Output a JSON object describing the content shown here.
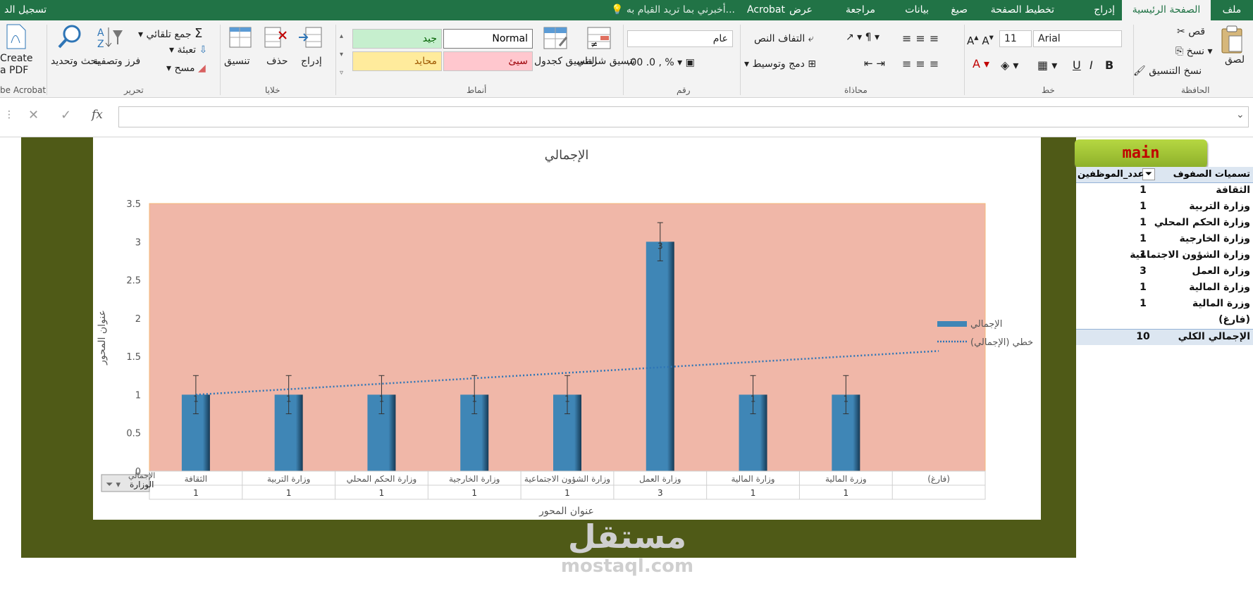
{
  "tabs": {
    "file": "ملف",
    "home": "الصفحة الرئيسية",
    "insert": "إدراج",
    "page_layout": "تخطيط الصفحة",
    "formulas": "صيغ",
    "data": "بيانات",
    "review": "مراجعة",
    "view": "عرض",
    "acrobat": "Acrobat",
    "tell_me": "أخبرني بما تريد القيام به...",
    "sign_in": "تسجيل الد"
  },
  "ribbon": {
    "clipboard": {
      "paste": "لصق",
      "cut": "قص",
      "copy": "نسخ",
      "format_painter": "نسخ التنسيق",
      "group": "الحافظة"
    },
    "font": {
      "name": "Arial",
      "size": "11",
      "group": "خط"
    },
    "alignment": {
      "wrap_text": "التفاف النص",
      "merge_center": "دمج وتوسيط",
      "group": "محاذاة"
    },
    "number": {
      "format": "عام",
      "group": "رقم"
    },
    "styles": {
      "conditional": "تنسيق شرطي",
      "format_table": "التنسيق كجدول",
      "normal": "Normal",
      "good": "جيد",
      "bad": "سيئ",
      "neutral": "محايد",
      "group": "أنماط"
    },
    "cells": {
      "insert": "إدراج",
      "delete": "حذف",
      "format": "تنسيق",
      "group": "خلايا"
    },
    "editing": {
      "autosum": "جمع تلقائي",
      "fill": "تعبئة",
      "clear": "مسح",
      "sort_filter": "فرز وتصفية",
      "find_select": "بحث وتحديد",
      "group": "تحرير"
    },
    "acrobat": {
      "create_pdf_1": "Create",
      "create_pdf_2": "a PDF",
      "group": "be Acrobat"
    }
  },
  "formula_bar": {
    "fx": "fx",
    "value": ""
  },
  "main_button": "main",
  "pivot": {
    "header_rows": "تسميات الصفوف",
    "header_count": "عدد_الموظفين",
    "rows": [
      {
        "label": "الثقافة",
        "value": "1"
      },
      {
        "label": "وزارة التربية",
        "value": "1"
      },
      {
        "label": "وزارة الحكم المحلي",
        "value": "1"
      },
      {
        "label": "وزارة الخارجية",
        "value": "1"
      },
      {
        "label": "وزارة الشؤون الاجتماعية",
        "value": "1"
      },
      {
        "label": "وزارة العمل",
        "value": "3"
      },
      {
        "label": "وزارة المالية",
        "value": "1"
      },
      {
        "label": "وزرة المالية",
        "value": "1"
      },
      {
        "label": "(فارغ)",
        "value": ""
      }
    ],
    "total_label": "الإجمالي الكلي",
    "total_value": "10"
  },
  "chart_data": {
    "type": "bar",
    "title": "الإجمالي",
    "categories": [
      "الثقافة",
      "وزارة التربية",
      "وزارة الحكم المحلي",
      "وزارة الخارجية",
      "وزارة الشؤون الاجتماعية",
      "وزارة العمل",
      "وزارة المالية",
      "وزرة المالية",
      "(فارغ)"
    ],
    "series": [
      {
        "name": "الإجمالي",
        "values": [
          1,
          1,
          1,
          1,
          1,
          3,
          1,
          1,
          null
        ]
      }
    ],
    "data_table_values": [
      "1",
      "1",
      "1",
      "1",
      "1",
      "3",
      "1",
      "1",
      ""
    ],
    "data_labels": [
      "1",
      "1",
      "1",
      "1",
      "1",
      "3",
      "1",
      "1",
      ""
    ],
    "error_bar": 0.25,
    "trendline": {
      "name": "خطي (الإجمالي)",
      "type": "linear"
    },
    "ylim": [
      0,
      3.5
    ],
    "yticks": [
      "0",
      "0.5",
      "1",
      "1.5",
      "2",
      "2.5",
      "3",
      "3.5"
    ],
    "xlabel": "عنوان المحور",
    "ylabel": "عنوان المحور",
    "legend_position": "right",
    "filter_field": "الوزارة",
    "data_table_legend": "الإجمالي",
    "colors": {
      "plot_bg": "#f0b7a8",
      "bar": "#3f86b6",
      "trend": "#2e75b6",
      "outer": "#4f5a17"
    }
  },
  "watermark": {
    "arabic": "مستقل",
    "latin": "mostaql.com"
  }
}
